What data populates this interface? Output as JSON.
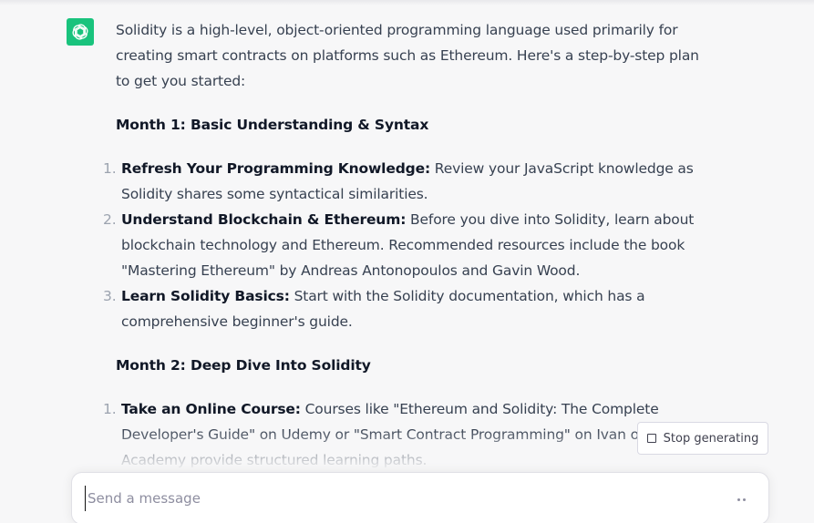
{
  "icons": {
    "assistant_avatar": "openai-logo-icon",
    "stop": "stop-square-icon",
    "typing": "ellipsis-icon"
  },
  "colors": {
    "avatar_bg": "#19c37d",
    "background": "#f7f7f8",
    "text": "#374151"
  },
  "response": {
    "intro": "Solidity is a high-level, object-oriented programming language used primarily for creating smart contracts on platforms such as Ethereum. Here's a step-by-step plan to get you started:",
    "months": [
      {
        "heading": "Month 1: Basic Understanding & Syntax",
        "items": [
          {
            "num": "1.",
            "title": "Refresh Your Programming Knowledge:",
            "text": " Review your JavaScript knowledge as Solidity shares some syntactical similarities."
          },
          {
            "num": "2.",
            "title": "Understand Blockchain & Ethereum:",
            "text": " Before you dive into Solidity, learn about blockchain technology and Ethereum. Recommended resources include the book \"Mastering Ethereum\" by Andreas Antonopoulos and Gavin Wood."
          },
          {
            "num": "3.",
            "title": "Learn Solidity Basics:",
            "text": " Start with the Solidity documentation, which has a comprehensive beginner's guide."
          }
        ]
      },
      {
        "heading": "Month 2: Deep Dive Into Solidity",
        "items": [
          {
            "num": "1.",
            "title": "Take an Online Course:",
            "text": " Courses like \"Ethereum and Solidity: The Complete Developer's Guide\" on Udemy or \"Smart Contract Programming\" on Ivan on Tech Academy provide structured learning paths."
          }
        ]
      }
    ]
  },
  "controls": {
    "stop_label": "Stop generating",
    "message_placeholder": "Send a message",
    "message_value": ""
  }
}
